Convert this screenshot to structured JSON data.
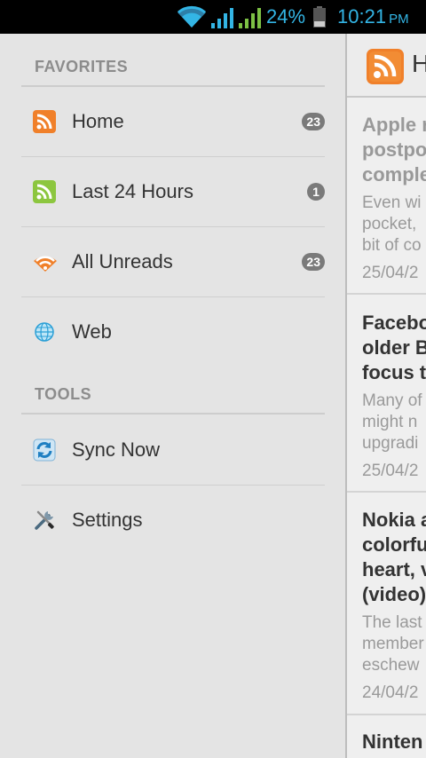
{
  "status_bar": {
    "battery_percent": "24%",
    "time": "10:21",
    "ampm": "PM",
    "accent_color": "#33b5e5"
  },
  "drawer": {
    "favorites_header": "FAVORITES",
    "tools_header": "TOOLS",
    "favorites": [
      {
        "label": "Home",
        "badge": "23",
        "icon": "rss-orange-icon"
      },
      {
        "label": "Last 24 Hours",
        "badge": "1",
        "icon": "rss-green-icon"
      },
      {
        "label": "All Unreads",
        "badge": "23",
        "icon": "unread-feed-icon"
      },
      {
        "label": "Web",
        "badge": "",
        "icon": "globe-icon"
      }
    ],
    "tools": [
      {
        "label": "Sync Now",
        "icon": "sync-icon"
      },
      {
        "label": "Settings",
        "icon": "settings-tools-icon"
      }
    ]
  },
  "content": {
    "header_title": "H",
    "articles": [
      {
        "title": [
          "Apple r",
          "postpo",
          "comple"
        ],
        "snippet": [
          "Even wi",
          "pocket,",
          "bit of co"
        ],
        "date": "25/04/2",
        "read": true
      },
      {
        "title": [
          "Facebo",
          "older B",
          "focus t"
        ],
        "snippet": [
          "Many of",
          "might n",
          "upgradi"
        ],
        "date": "25/04/2",
        "read": false
      },
      {
        "title": [
          "Nokia a",
          "colorfu",
          "heart, v",
          "(video)"
        ],
        "snippet": [
          "The last",
          "member",
          "eschew"
        ],
        "date": "24/04/2",
        "read": false
      },
      {
        "title": [
          "Ninten"
        ],
        "snippet": [],
        "date": "",
        "read": false
      }
    ]
  }
}
